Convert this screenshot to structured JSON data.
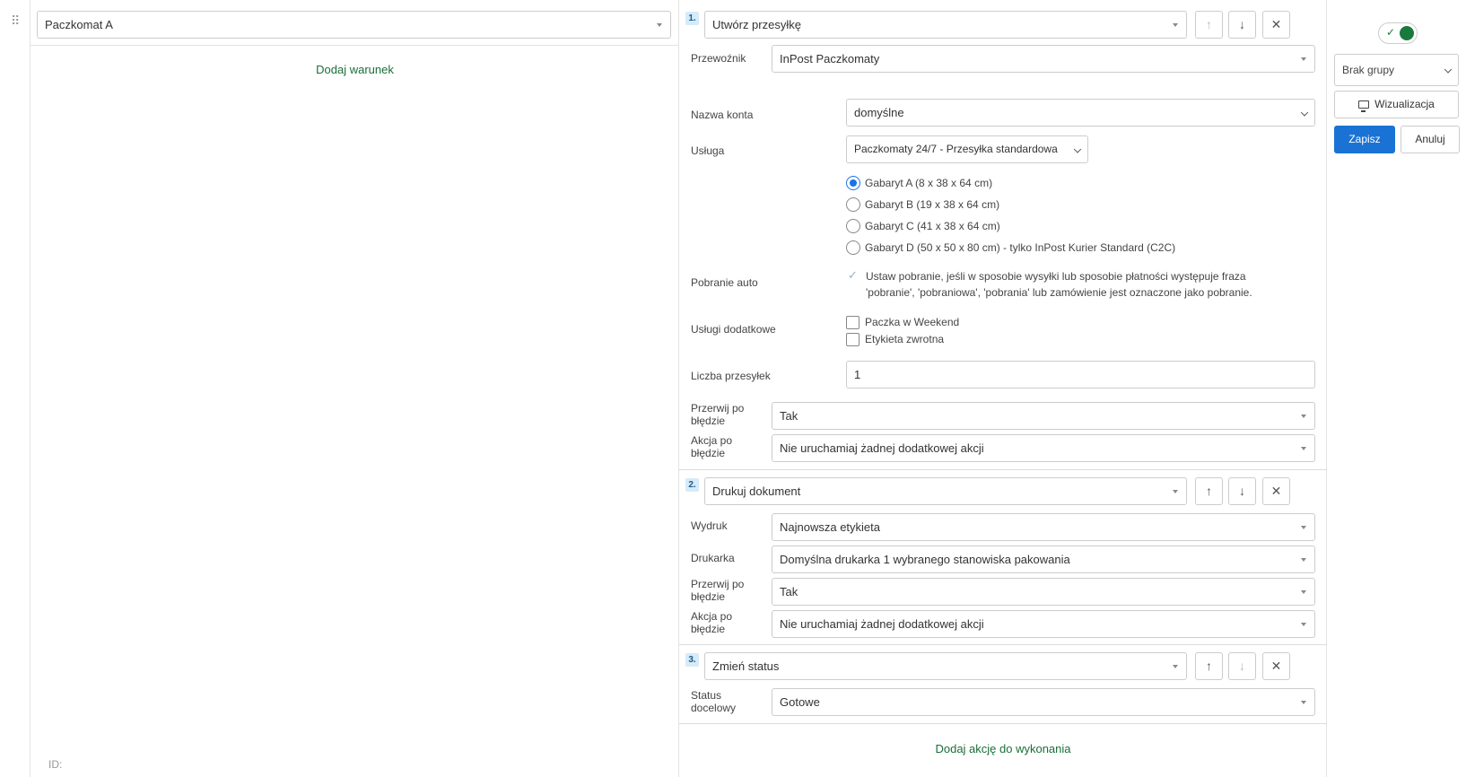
{
  "conditions": {
    "select_value": "Paczkomat A",
    "add_label": "Dodaj warunek",
    "id_label": "ID:"
  },
  "actions": [
    {
      "num": "1.",
      "type": "Utwórz przesyłkę",
      "carrier_label": "Przewoźnik",
      "carrier_value": "InPost Paczkomaty",
      "account_label": "Nazwa konta",
      "account_value": "domyślne",
      "service_label": "Usługa",
      "service_value": "Paczkomaty 24/7 - Przesyłka standardowa",
      "sizes": [
        {
          "label": "Gabaryt A (8 x 38 x 64 cm)",
          "selected": true
        },
        {
          "label": "Gabaryt B (19 x 38 x 64 cm)",
          "selected": false
        },
        {
          "label": "Gabaryt C (41 x 38 x 64 cm)",
          "selected": false
        },
        {
          "label": "Gabaryt D (50 x 50 x 80 cm) - tylko InPost Kurier Standard (C2C)",
          "selected": false
        }
      ],
      "pobranie_label": "Pobranie auto",
      "pobranie_text": "Ustaw pobranie, jeśli w sposobie wysyłki lub sposobie płatności występuje fraza 'pobranie', 'pobraniowa', 'pobrania' lub zamówienie jest oznaczone jako pobranie.",
      "extra_label": "Usługi dodatkowe",
      "extras": [
        "Paczka w Weekend",
        "Etykieta zwrotna"
      ],
      "count_label": "Liczba przesyłek",
      "count_value": "1",
      "break_label": "Przerwij po błędzie",
      "break_value": "Tak",
      "error_action_label": "Akcja po błędzie",
      "error_action_value": "Nie uruchamiaj żadnej dodatkowej akcji"
    },
    {
      "num": "2.",
      "type": "Drukuj dokument",
      "print_label": "Wydruk",
      "print_value": "Najnowsza etykieta",
      "printer_label": "Drukarka",
      "printer_value": "Domyślna drukarka 1 wybranego stanowiska pakowania",
      "break_label": "Przerwij po błędzie",
      "break_value": "Tak",
      "error_action_label": "Akcja po błędzie",
      "error_action_value": "Nie uruchamiaj żadnej dodatkowej akcji"
    },
    {
      "num": "3.",
      "type": "Zmień status",
      "status_label": "Status docelowy",
      "status_value": "Gotowe"
    }
  ],
  "add_action_label": "Dodaj akcję do wykonania",
  "sidebar": {
    "group_value": "Brak grupy",
    "visualize_label": "Wizualizacja",
    "save_label": "Zapisz",
    "cancel_label": "Anuluj",
    "toggle_on": true
  },
  "icons": {
    "drag": "drag-handle-icon",
    "up": "arrow-up-icon",
    "down": "arrow-down-icon",
    "close": "close-icon",
    "monitor": "monitor-icon",
    "check": "check-icon"
  },
  "colors": {
    "accent_green": "#1a6e3a",
    "primary_blue": "#1a73d4",
    "badge_bg": "#d6ebf8"
  }
}
